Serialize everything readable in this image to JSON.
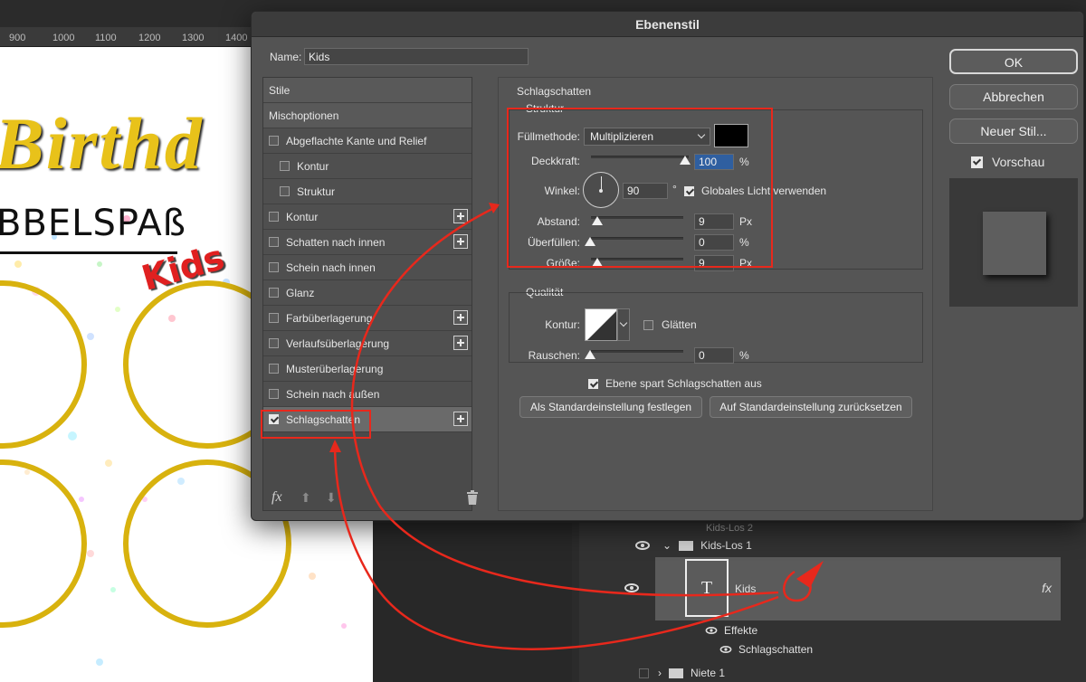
{
  "ruler": {
    "ticks": [
      "900",
      "1000",
      "1100",
      "1200",
      "1300",
      "1400"
    ]
  },
  "canvas": {
    "title_fragment": "Birthd",
    "subtitle_fragment": "BBELSPAß",
    "kids_text": "Kids"
  },
  "dialog": {
    "title": "Ebenenstil",
    "name_label": "Name:",
    "name_value": "Kids",
    "styles": [
      {
        "label": "Stile",
        "type": "header"
      },
      {
        "label": "Mischoptionen",
        "type": "header"
      },
      {
        "label": "Abgeflachte Kante und Relief",
        "checked": false,
        "plus": false
      },
      {
        "label": "Kontur",
        "checked": false,
        "plus": false,
        "indent": true
      },
      {
        "label": "Struktur",
        "checked": false,
        "plus": false,
        "indent": true
      },
      {
        "label": "Kontur",
        "checked": false,
        "plus": true
      },
      {
        "label": "Schatten nach innen",
        "checked": false,
        "plus": true
      },
      {
        "label": "Schein nach innen",
        "checked": false,
        "plus": false
      },
      {
        "label": "Glanz",
        "checked": false,
        "plus": false
      },
      {
        "label": "Farbüberlagerung",
        "checked": false,
        "plus": true
      },
      {
        "label": "Verlaufsüberlagerung",
        "checked": false,
        "plus": true
      },
      {
        "label": "Musterüberlagerung",
        "checked": false,
        "plus": false
      },
      {
        "label": "Schein nach außen",
        "checked": false,
        "plus": false
      },
      {
        "label": "Schlagschatten",
        "checked": true,
        "plus": true,
        "selected": true
      }
    ],
    "footer_fx": "fx",
    "panel": {
      "section": "Schlagschatten",
      "struktur": "Struktur",
      "blend_label": "Füllmethode:",
      "blend_value": "Multiplizieren",
      "shadow_color": "#000000",
      "opacity_label": "Deckkraft:",
      "opacity_value": "100",
      "opacity_unit": "%",
      "opacity_level": 1.0,
      "angle_label": "Winkel:",
      "angle_value": "90",
      "angle_unit": "°",
      "global_light_label": "Globales Licht verwenden",
      "global_light_checked": true,
      "distance_label": "Abstand:",
      "distance_value": "9",
      "distance_unit": "Px",
      "spread_label": "Überfüllen:",
      "spread_value": "0",
      "spread_unit": "%",
      "size_label": "Größe:",
      "size_value": "9",
      "size_unit": "Px",
      "quality": "Qualität",
      "contour_label": "Kontur:",
      "antialias_label": "Glätten",
      "antialias_checked": false,
      "noise_label": "Rauschen:",
      "noise_value": "0",
      "noise_unit": "%",
      "knockout_label": "Ebene spart Schlagschatten aus",
      "knockout_checked": true,
      "set_default_label": "Als Standardeinstellung festlegen",
      "reset_default_label": "Auf Standardeinstellung zurücksetzen"
    },
    "buttons": {
      "ok": "OK",
      "cancel": "Abbrechen",
      "new_style": "Neuer Stil...",
      "preview_label": "Vorschau",
      "preview_checked": true
    }
  },
  "layers": {
    "rows": [
      {
        "name": "Kids-Los 2"
      },
      {
        "name": "Kids-Los 1"
      },
      {
        "name": "Kids",
        "thumb": "T",
        "fx": "fx"
      },
      {
        "name": "Effekte"
      },
      {
        "name": "Schlagschatten"
      },
      {
        "name": "Niete 1"
      }
    ]
  },
  "colors": {
    "annotation_red": "#e8281c",
    "gold": "#d8b20e"
  }
}
